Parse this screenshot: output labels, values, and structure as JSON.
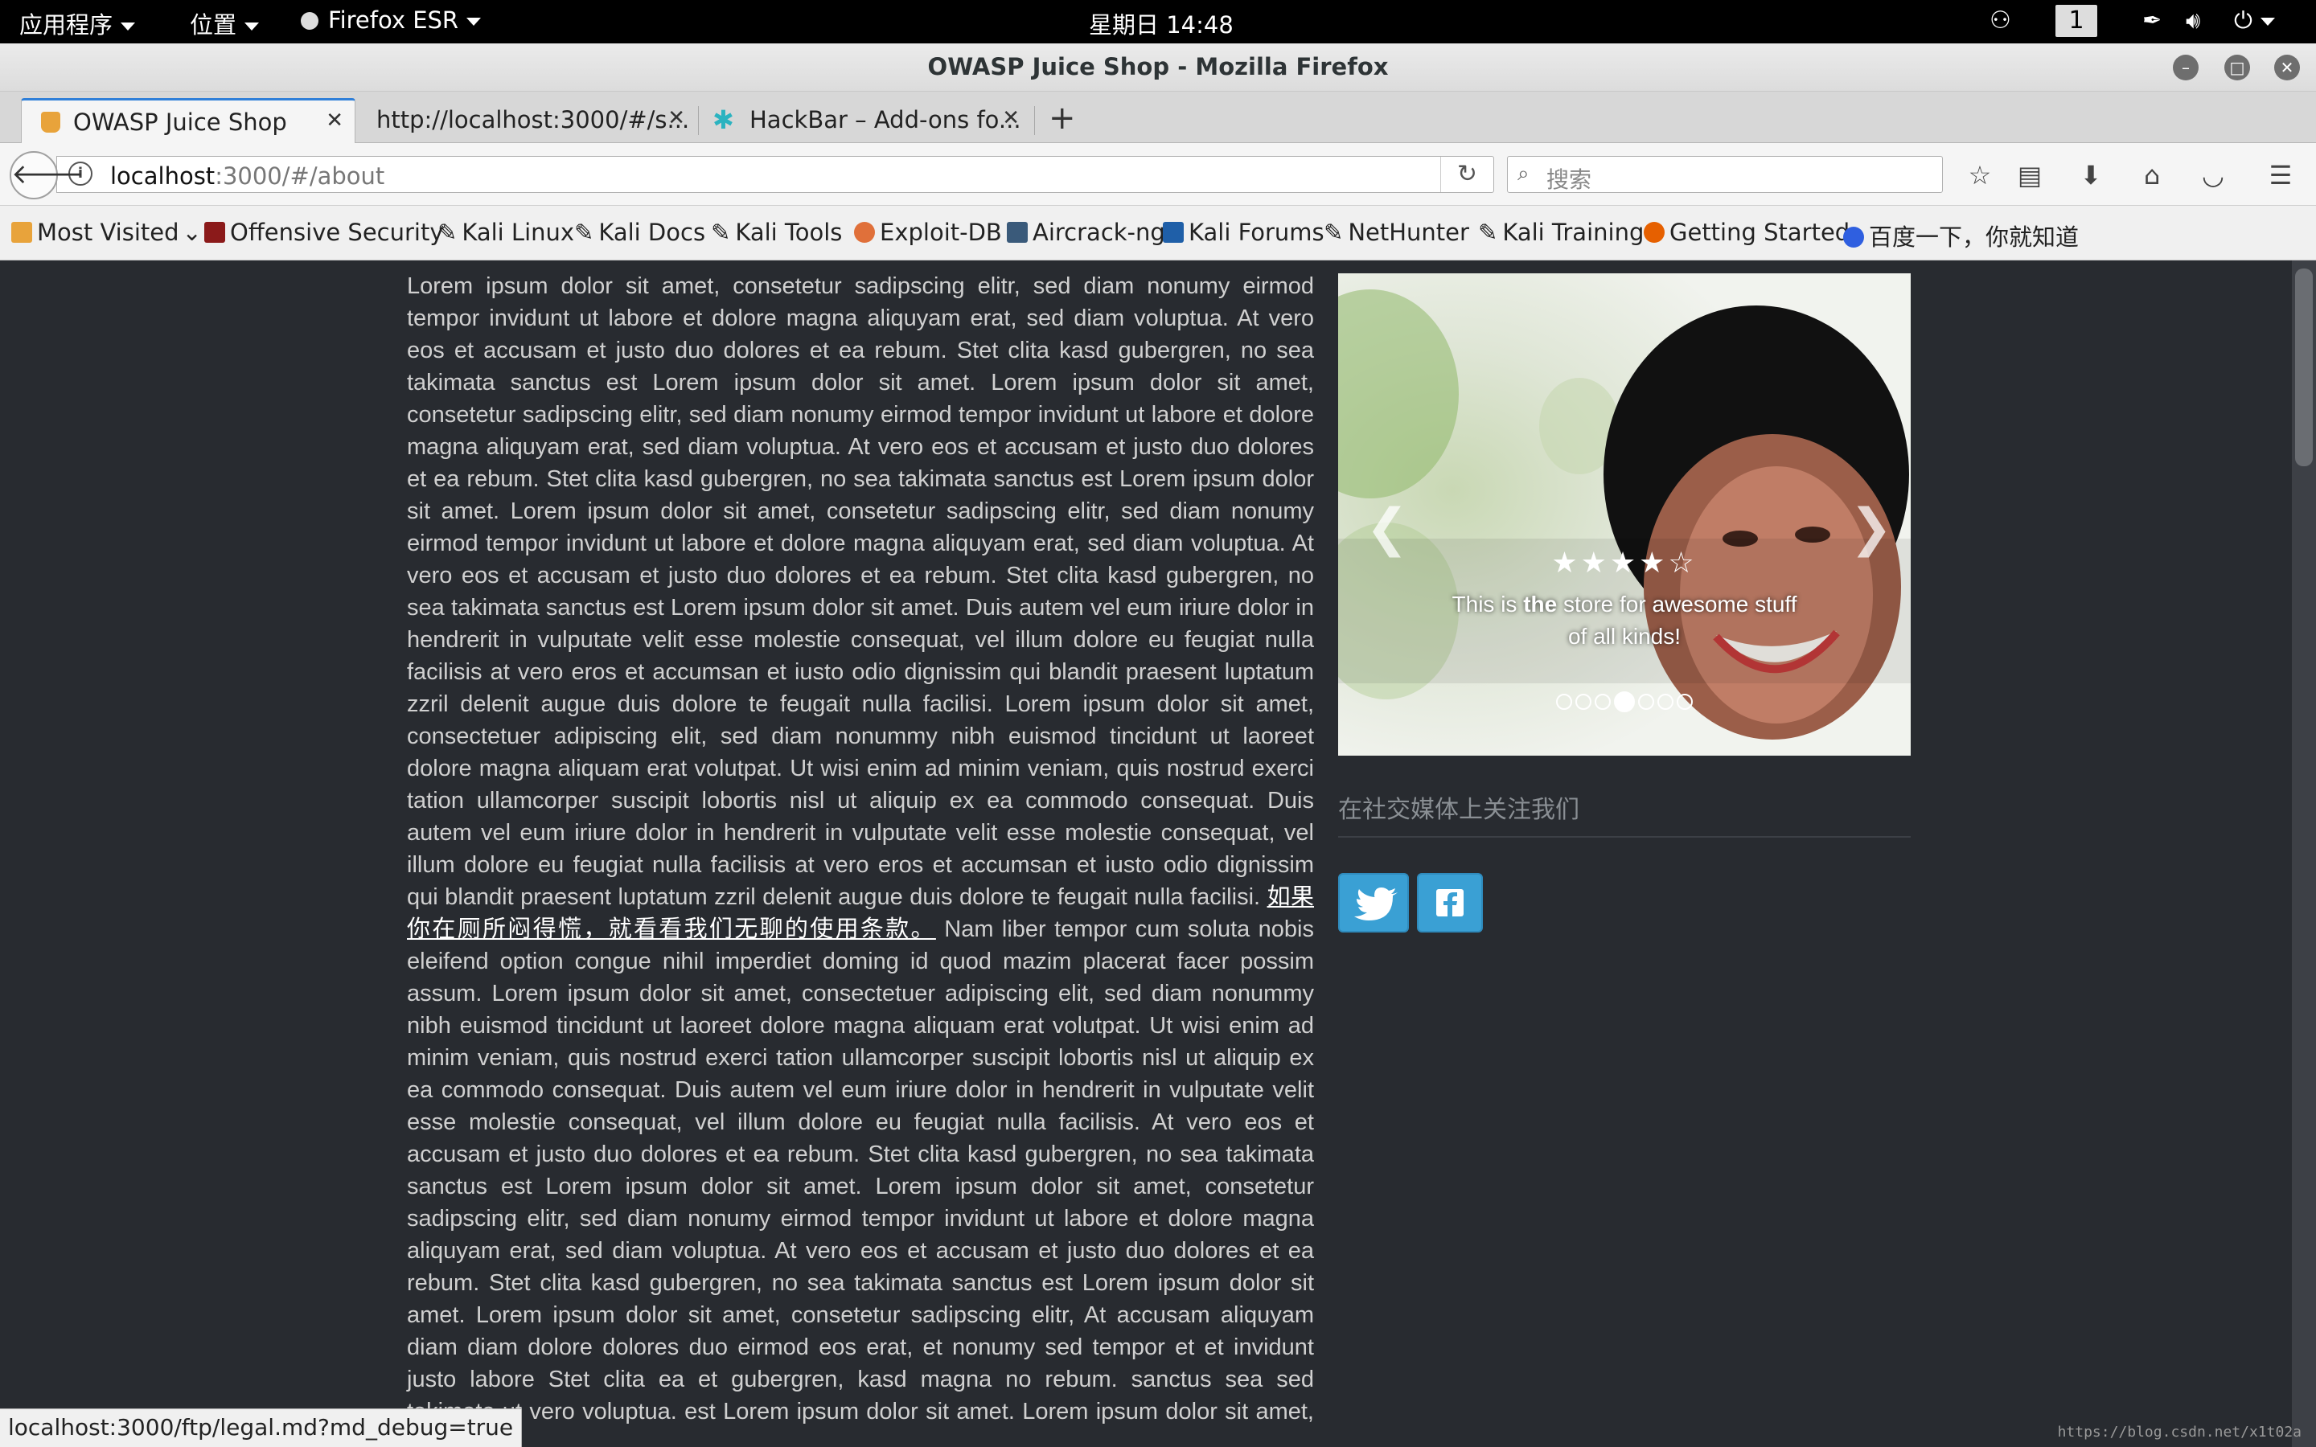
{
  "system_bar": {
    "apps_label": "应用程序",
    "places_label": "位置",
    "active_app_label": "Firefox ESR",
    "clock": "星期日 14:48",
    "workspace": "1"
  },
  "window": {
    "title": "OWASP Juice Shop - Mozilla Firefox"
  },
  "tabs": [
    {
      "label": "OWASP Juice Shop",
      "icon": "juice-shop-icon",
      "active": true
    },
    {
      "label": "http://localhost:3000/#/s...",
      "icon": "",
      "active": false
    },
    {
      "label": "HackBar – Add-ons fo...",
      "icon": "puzzle-icon",
      "active": false
    }
  ],
  "new_tab_label": "+",
  "address_bar": {
    "host": "localhost",
    "path": ":3000/#/about"
  },
  "search_bar": {
    "placeholder": "搜索"
  },
  "bookmarks": [
    {
      "label": "Most Visited",
      "icon": "folder-icon",
      "color": "#e8a33b"
    },
    {
      "label": "Offensive Security",
      "icon": "offsec-icon",
      "color": "#8b1a1a"
    },
    {
      "label": "Kali Linux",
      "icon": "kali-dragon-icon",
      "color": "#222222"
    },
    {
      "label": "Kali Docs",
      "icon": "kali-dragon-icon",
      "color": "#222222"
    },
    {
      "label": "Kali Tools",
      "icon": "kali-dragon-icon",
      "color": "#222222"
    },
    {
      "label": "Exploit-DB",
      "icon": "exploit-db-icon",
      "color": "#e0703a"
    },
    {
      "label": "Aircrack-ng",
      "icon": "aircrack-icon",
      "color": "#3a5a7a"
    },
    {
      "label": "Kali Forums",
      "icon": "kali-forums-icon",
      "color": "#1f5fa8"
    },
    {
      "label": "NetHunter",
      "icon": "kali-dragon-icon",
      "color": "#222222"
    },
    {
      "label": "Kali Training",
      "icon": "kali-dragon-icon",
      "color": "#222222"
    },
    {
      "label": "Getting Started",
      "icon": "firefox-icon",
      "color": "#e66000"
    },
    {
      "label": "百度一下，你就知道",
      "icon": "baidu-icon",
      "color": "#2f5fe0"
    }
  ],
  "about": {
    "text_part1": "Lorem ipsum dolor sit amet, consetetur sadipscing elitr, sed diam nonumy eirmod tempor invidunt ut labore et dolore magna aliquyam erat, sed diam voluptua. At vero eos et accusam et justo duo dolores et ea rebum. Stet clita kasd gubergren, no sea takimata sanctus est Lorem ipsum dolor sit amet. Lorem ipsum dolor sit amet, consetetur sadipscing elitr, sed diam nonumy eirmod tempor invidunt ut labore et dolore magna aliquyam erat, sed diam voluptua. At vero eos et accusam et justo duo dolores et ea rebum. Stet clita kasd gubergren, no sea takimata sanctus est Lorem ipsum dolor sit amet. Lorem ipsum dolor sit amet, consetetur sadipscing elitr, sed diam nonumy eirmod tempor invidunt ut labore et dolore magna aliquyam erat, sed diam voluptua. At vero eos et accusam et justo duo dolores et ea rebum. Stet clita kasd gubergren, no sea takimata sanctus est Lorem ipsum dolor sit amet. Duis autem vel eum iriure dolor in hendrerit in vulputate velit esse molestie consequat, vel illum dolore eu feugiat nulla facilisis at vero eros et accumsan et iusto odio dignissim qui blandit praesent luptatum zzril delenit augue duis dolore te feugait nulla facilisi. Lorem ipsum dolor sit amet, consectetuer adipiscing elit, sed diam nonummy nibh euismod tincidunt ut laoreet dolore magna aliquam erat volutpat. Ut wisi enim ad minim veniam, quis nostrud exerci tation ullamcorper suscipit lobortis nisl ut aliquip ex ea commodo consequat. Duis autem vel eum iriure dolor in hendrerit in vulputate velit esse molestie consequat, vel illum dolore eu feugiat nulla facilisis at vero eros et accumsan et iusto odio dignissim qui blandit praesent luptatum zzril delenit augue duis dolore te feugait nulla facilisi. ",
    "legal_link": "如果你在厕所闷得慌，就看看我们无聊的使用条款。",
    "text_part2": " Nam liber tempor cum soluta nobis eleifend option congue nihil imperdiet doming id quod mazim placerat facer possim assum. Lorem ipsum dolor sit amet, consectetuer adipiscing elit, sed diam nonummy nibh euismod tincidunt ut laoreet dolore magna aliquam erat volutpat. Ut wisi enim ad minim veniam, quis nostrud exerci tation ullamcorper suscipit lobortis nisl ut aliquip ex ea commodo consequat. Duis autem vel eum iriure dolor in hendrerit in vulputate velit esse molestie consequat, vel illum dolore eu feugiat nulla facilisis. At vero eos et accusam et justo duo dolores et ea rebum. Stet clita kasd gubergren, no sea takimata sanctus est Lorem ipsum dolor sit amet. Lorem ipsum dolor sit amet, consetetur sadipscing elitr, sed diam nonumy eirmod tempor invidunt ut labore et dolore magna aliquyam erat, sed diam voluptua. At vero eos et accusam et justo duo dolores et ea rebum. Stet clita kasd gubergren, no sea takimata sanctus est Lorem ipsum dolor sit amet. Lorem ipsum dolor sit amet, consetetur sadipscing elitr, At accusam aliquyam diam diam dolore dolores duo eirmod eos erat, et nonumy sed tempor et et invidunt justo labore Stet clita ea et gubergren, kasd magna no rebum. sanctus sea sed takimata ut vero voluptua. est Lorem ipsum dolor sit amet. Lorem ipsum dolor sit amet, consetetur."
  },
  "carousel": {
    "rating": 4,
    "rating_max": 5,
    "stars_text": "★★★★☆",
    "caption_pre": "This is ",
    "caption_bold": "the",
    "caption_post": " store for awesome stuff of all kinds!",
    "slide_count": 7,
    "active_slide": 4,
    "prev_glyph": "❮",
    "next_glyph": "❯"
  },
  "social": {
    "title": "在社交媒体上关注我们",
    "buttons": [
      "twitter-icon",
      "facebook-icon"
    ],
    "button_color": "#3aa0d4"
  },
  "status_bar": {
    "link_url": "localhost:3000/ftp/legal.md?md_debug=true"
  },
  "watermark": "https://blog.csdn.net/x1t02a"
}
